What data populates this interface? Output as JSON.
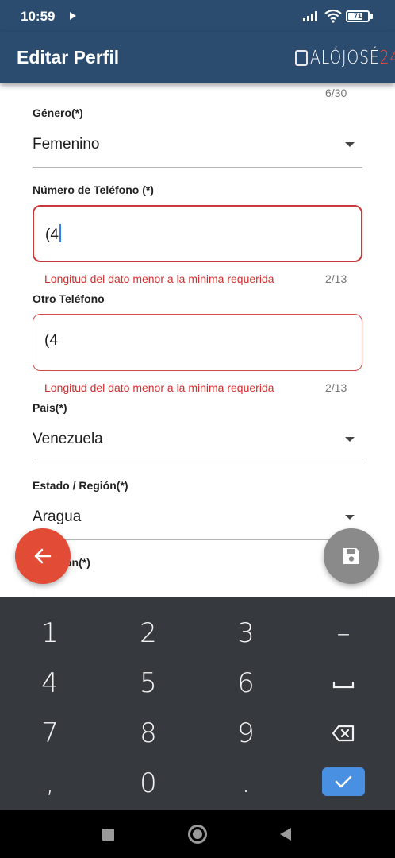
{
  "status_bar": {
    "time": "10:59",
    "battery_level": "71",
    "icons": [
      "play-icon",
      "signal-icon",
      "wifi-icon",
      "battery-icon"
    ]
  },
  "app_bar": {
    "title": "Editar Perfil",
    "brand_text": "ALÓJOSÉ",
    "brand_number": "24",
    "brand_accent_color": "#e84c3d",
    "background_color": "#2b4b6f"
  },
  "form": {
    "top_counter": "6/30",
    "gender": {
      "label": "Género(*)",
      "value": "Femenino"
    },
    "phone": {
      "label": "Número de Teléfono (*)",
      "value": "(4",
      "error": "Longitud del dato menor a la minima requerida",
      "counter": "2/13"
    },
    "other_phone": {
      "label": "Otro Teléfono",
      "value": "(4",
      "error": "Longitud del dato menor a la minima requerida",
      "counter": "2/13"
    },
    "country": {
      "label": "País(*)",
      "value": "Venezuela"
    },
    "state": {
      "label": "Estado / Región(*)",
      "value": "Aragua"
    },
    "partial_field_label": "ón(*)",
    "error_color": "#d32f2f"
  },
  "fabs": {
    "back_icon": "arrow-left-icon",
    "back_color": "#e24b35",
    "save_icon": "save-icon",
    "save_color": "#8a8a8a"
  },
  "keyboard": {
    "keys": [
      "1",
      "2",
      "3",
      "–",
      "4",
      "5",
      "6",
      "",
      "7",
      "8",
      "9",
      "",
      ",",
      "0",
      ".",
      ""
    ],
    "space_icon": "space-icon",
    "backspace_icon": "backspace-icon",
    "done_icon": "check-icon",
    "done_color": "#4a90e2"
  },
  "nav_bar": {
    "icons": [
      "recent-apps-icon",
      "home-icon",
      "back-icon"
    ]
  }
}
